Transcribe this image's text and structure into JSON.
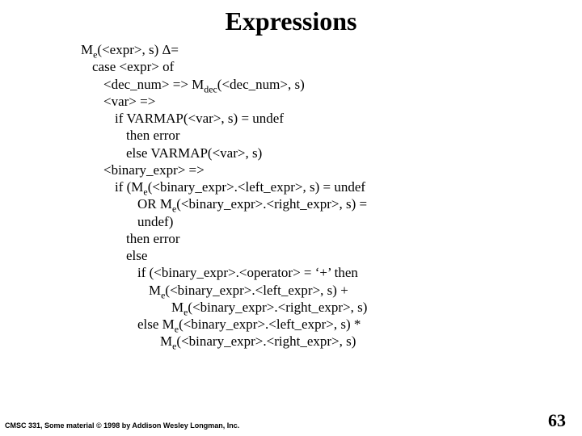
{
  "title": "Expressions",
  "lines": {
    "l0": "M_e(<expr>, s) Δ=",
    "l1": "case <expr> of",
    "l2": "<dec_num> => M_dec(<dec_num>, s)",
    "l3": "<var> =>",
    "l4": "if VARMAP(<var>, s) = undef",
    "l5": "then error",
    "l6": "else VARMAP(<var>, s)",
    "l7": "<binary_expr> =>",
    "l8": "if (M_e(<binary_expr>.<left_expr>, s) = undef",
    "l9": "OR M_e(<binary_expr>.<right_expr>, s) =",
    "l10": "undef)",
    "l11": "then error",
    "l12": "else",
    "l13": "if (<binary_expr>.<operator> = ‘+’ then",
    "l14": "M_e(<binary_expr>.<left_expr>, s) +",
    "l15": "M_e(<binary_expr>.<right_expr>, s)",
    "l16": "else M_e(<binary_expr>.<left_expr>, s) *",
    "l17": "M_e(<binary_expr>.<right_expr>, s)"
  },
  "footer_left": "CMSC 331, Some material © 1998 by Addison Wesley Longman, Inc.",
  "page_number": "63"
}
